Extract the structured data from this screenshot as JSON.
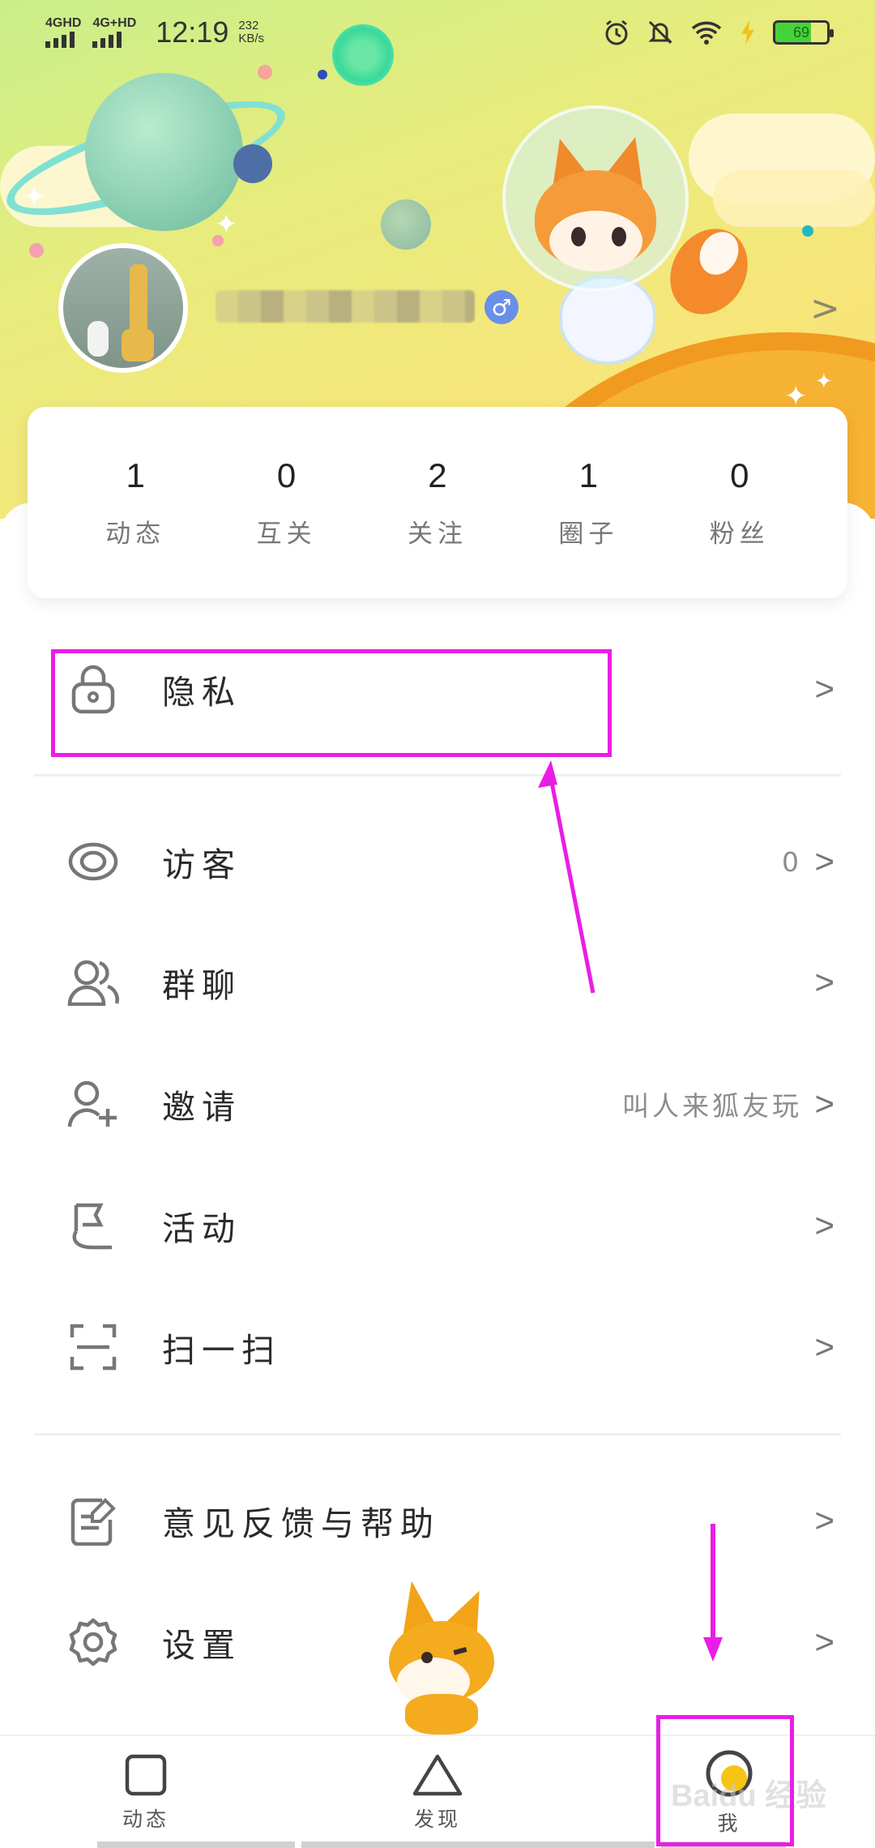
{
  "status_bar": {
    "sim1": "4GHD",
    "sim2": "4G+HD",
    "time": "12:19",
    "net_speed_value": "232",
    "net_speed_unit": "KB/s",
    "battery": "69"
  },
  "stats": [
    {
      "value": "1",
      "label": "动态"
    },
    {
      "value": "0",
      "label": "互关"
    },
    {
      "value": "2",
      "label": "关注"
    },
    {
      "value": "1",
      "label": "圈子"
    },
    {
      "value": "0",
      "label": "粉丝"
    }
  ],
  "menu": {
    "privacy": {
      "label": "隐私"
    },
    "visitors": {
      "label": "访客",
      "extra": "0"
    },
    "group_chat": {
      "label": "群聊"
    },
    "invite": {
      "label": "邀请",
      "extra": "叫人来狐友玩"
    },
    "activity": {
      "label": "活动"
    },
    "scan": {
      "label": "扫一扫"
    },
    "feedback": {
      "label": "意见反馈与帮助"
    },
    "settings": {
      "label": "设置"
    },
    "chevron": ">"
  },
  "bottom_nav": [
    {
      "label": "动态"
    },
    {
      "label": "发现"
    },
    {
      "label": "我"
    }
  ],
  "profile": {
    "gender_symbol": "♂",
    "chevron": ">"
  },
  "watermark": "Baidu 经验",
  "colors": {
    "highlight": "#e91ee6",
    "header_start": "#c9ef8a",
    "header_end": "#f8dc6a"
  }
}
